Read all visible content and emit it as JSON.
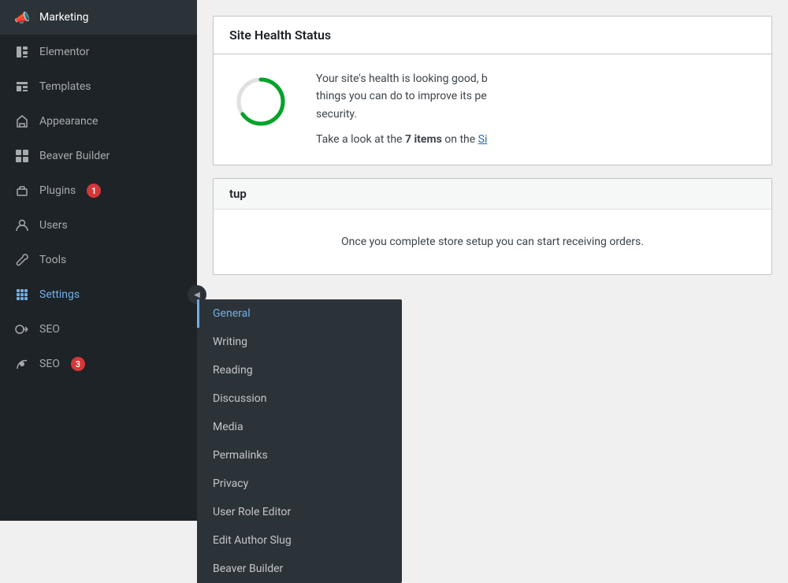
{
  "sidebar": {
    "items": [
      {
        "id": "marketing",
        "label": "Marketing",
        "icon": "📣"
      },
      {
        "id": "elementor",
        "label": "Elementor",
        "icon": "⊟"
      },
      {
        "id": "templates",
        "label": "Templates",
        "icon": "🗂"
      },
      {
        "id": "appearance",
        "label": "Appearance",
        "icon": "🖌"
      },
      {
        "id": "beaver-builder",
        "label": "Beaver Builder",
        "icon": "⊞"
      },
      {
        "id": "plugins",
        "label": "Plugins",
        "icon": "🔌",
        "badge": "1"
      },
      {
        "id": "users",
        "label": "Users",
        "icon": "👤"
      },
      {
        "id": "tools",
        "label": "Tools",
        "icon": "🔧"
      },
      {
        "id": "settings",
        "label": "Settings",
        "icon": "⊞",
        "active": true
      },
      {
        "id": "seo",
        "label": "SEO",
        "icon": "≡O"
      },
      {
        "id": "seo2",
        "label": "SEO",
        "icon": "Y",
        "badge": "3"
      }
    ]
  },
  "dropdown": {
    "items": [
      {
        "id": "general",
        "label": "General",
        "active": true
      },
      {
        "id": "writing",
        "label": "Writing"
      },
      {
        "id": "reading",
        "label": "Reading"
      },
      {
        "id": "discussion",
        "label": "Discussion"
      },
      {
        "id": "media",
        "label": "Media"
      },
      {
        "id": "permalinks",
        "label": "Permalinks"
      },
      {
        "id": "privacy",
        "label": "Privacy"
      },
      {
        "id": "user-role-editor",
        "label": "User Role Editor"
      },
      {
        "id": "edit-author-slug",
        "label": "Edit Author Slug"
      },
      {
        "id": "beaver-builder",
        "label": "Beaver Builder"
      }
    ]
  },
  "main": {
    "site_health": {
      "title": "Site Health Status",
      "description": "Your site's health is looking good, b things you can do to improve its pe security.",
      "cta_start": "Take a look at the ",
      "items_bold": "7 items",
      "cta_end": " on the ",
      "link_text": "Si"
    },
    "store_setup": {
      "section_title": "tup",
      "body": "Once you complete store setup you can start receiving orders."
    }
  }
}
